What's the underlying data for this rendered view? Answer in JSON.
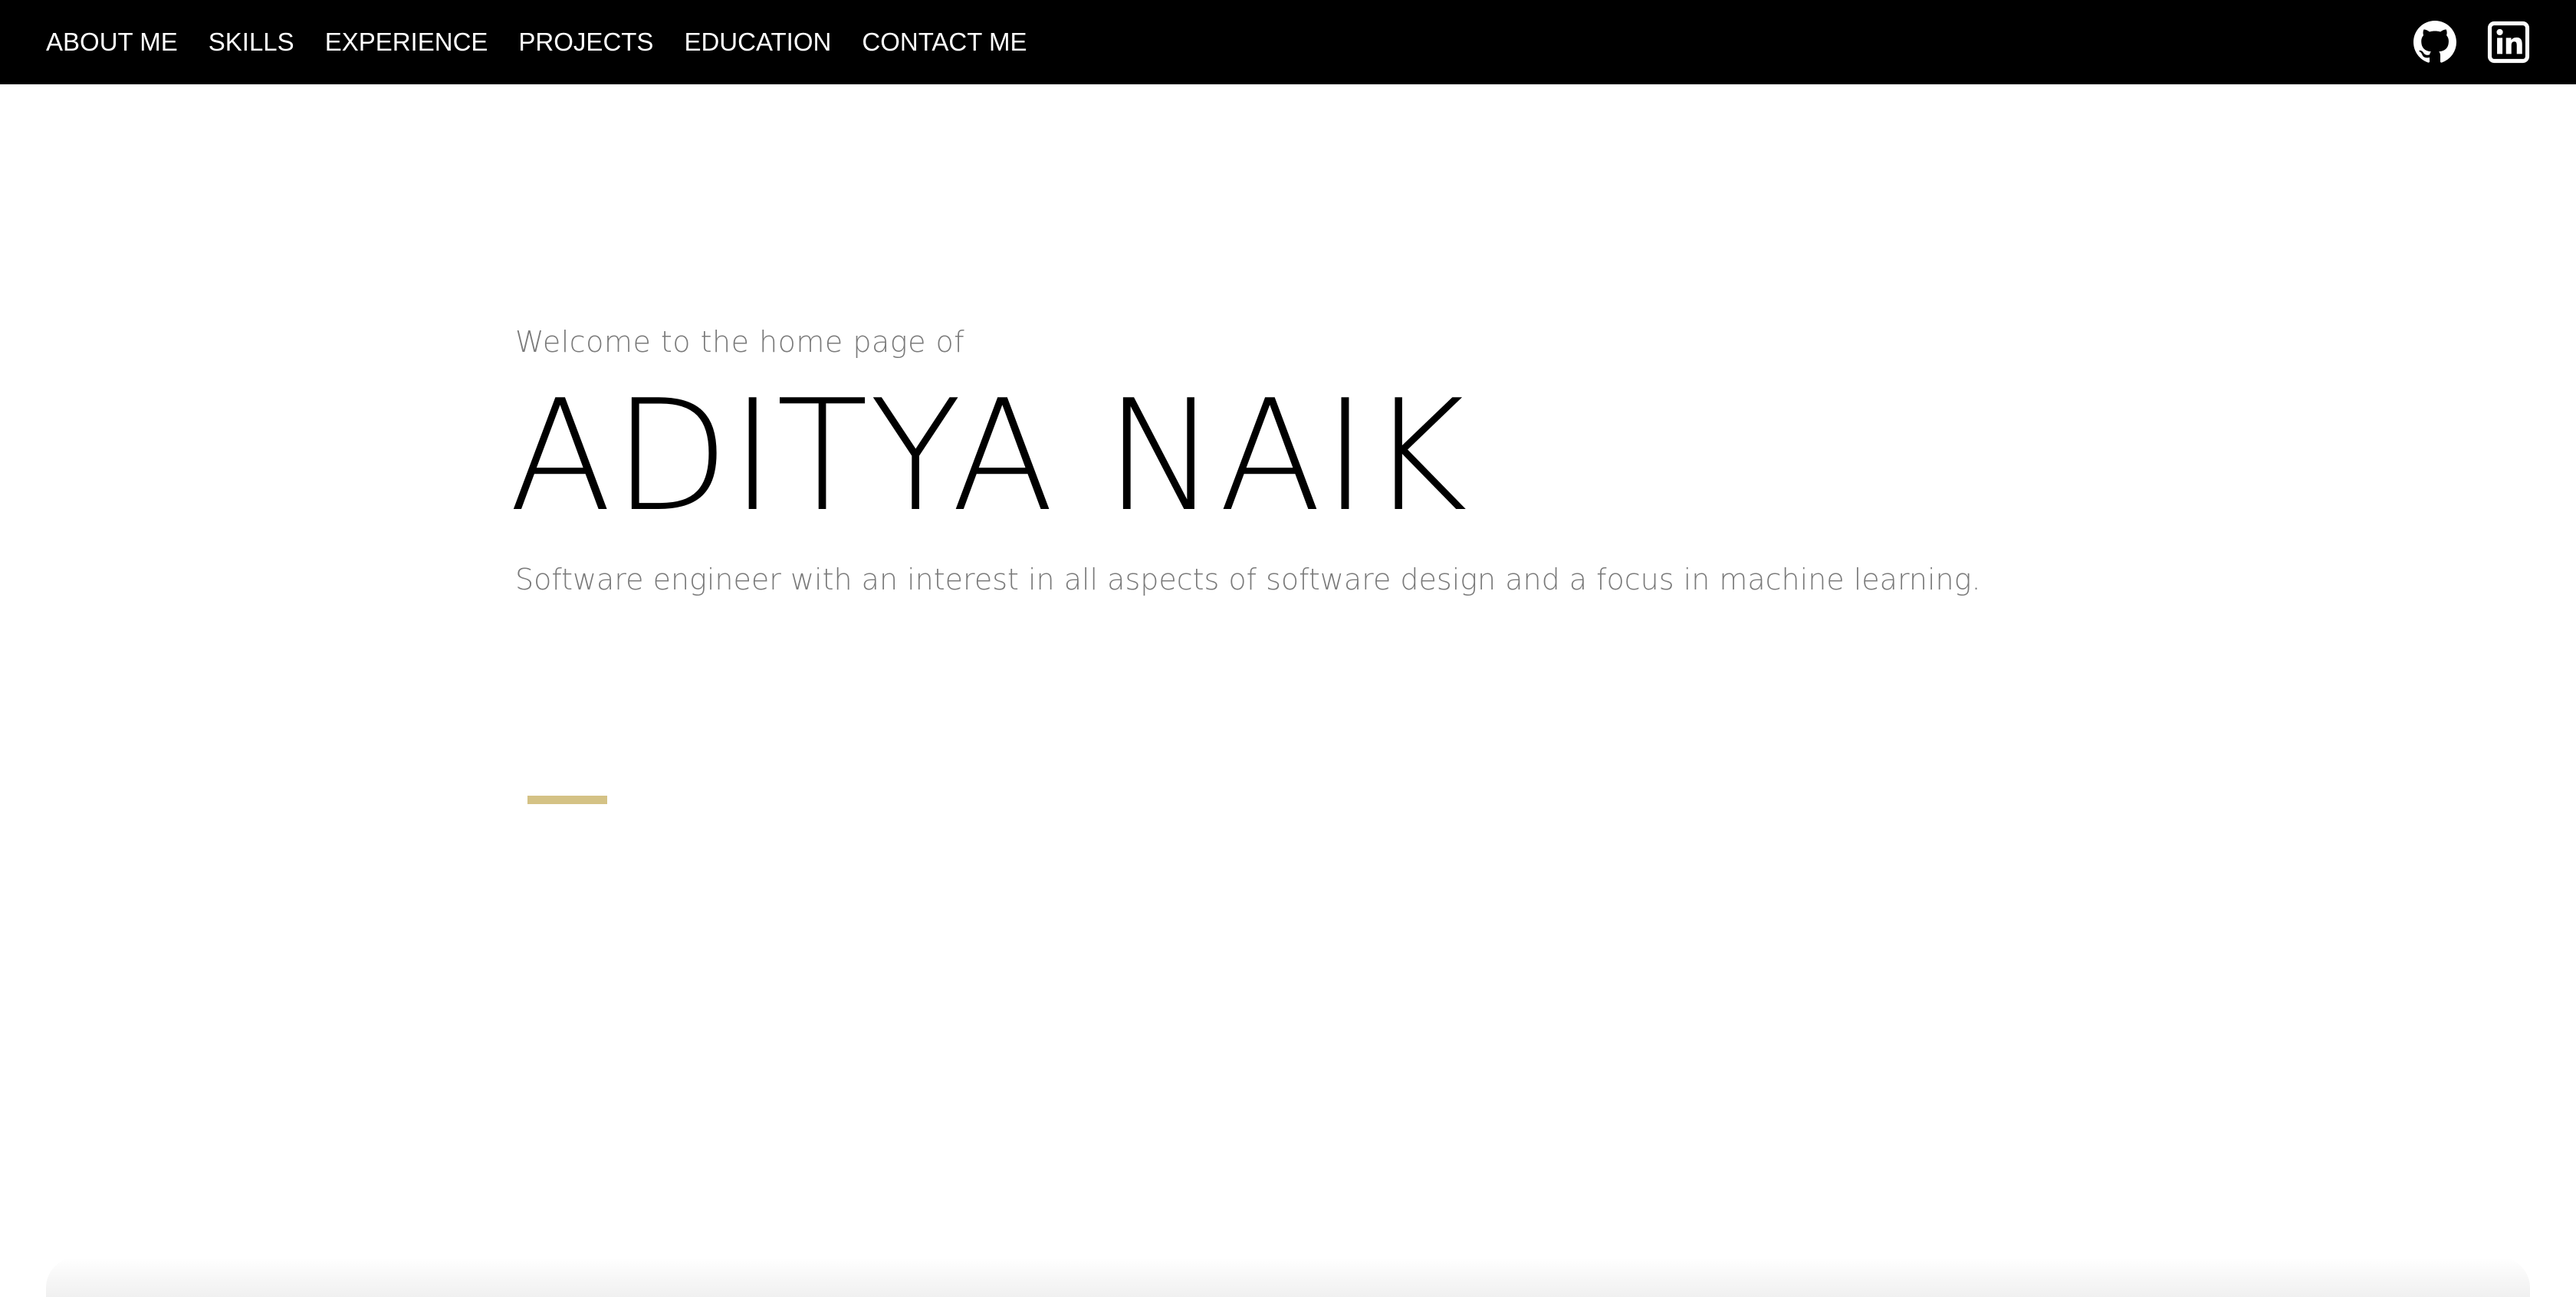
{
  "nav": {
    "items": [
      {
        "label": "ABOUT ME"
      },
      {
        "label": "SKILLS"
      },
      {
        "label": "EXPERIENCE"
      },
      {
        "label": "PROJECTS"
      },
      {
        "label": "EDUCATION"
      },
      {
        "label": "CONTACT ME"
      }
    ],
    "icons": [
      "github-icon",
      "linkedin-icon"
    ]
  },
  "hero": {
    "intro": "Welcome to the home page of",
    "name": "ADITYA NAIK",
    "tagline": "Software engineer with an interest in all aspects of software design and a focus in machine learning."
  },
  "colors": {
    "navbar_bg": "#000000",
    "nav_text": "#ffffff",
    "muted_text": "#7a7a7a",
    "accent": "#d4c285"
  }
}
